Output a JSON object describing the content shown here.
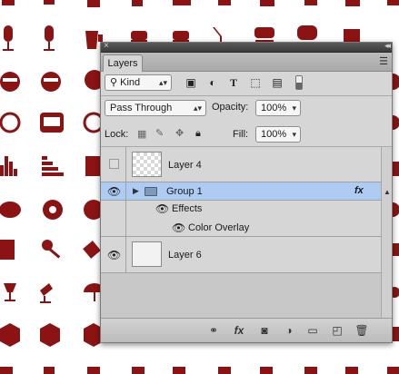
{
  "panel": {
    "tab_label": "Layers",
    "close_glyph": "×",
    "collapse_glyph": "◂◂",
    "menu_glyph": "☰"
  },
  "filter": {
    "kind_label": "Kind",
    "kind_icon": "search-icon",
    "filter_icons": [
      "image-filter-icon",
      "adjustment-filter-icon",
      "type-filter-icon",
      "shape-filter-icon",
      "smart-object-filter-icon"
    ]
  },
  "blend": {
    "mode": "Pass Through",
    "opacity_label": "Opacity:",
    "opacity_value": "100%",
    "fill_label": "Fill:",
    "fill_value": "100%",
    "lock_label": "Lock:"
  },
  "layers": [
    {
      "name": "Layer 4",
      "visible": false,
      "thumb": "transparent"
    },
    {
      "name": "Group 1",
      "visible": true,
      "selected": true,
      "fx": "fx",
      "effects_label": "Effects",
      "effect_items": [
        "Color Overlay"
      ]
    },
    {
      "name": "Layer 6",
      "visible": true,
      "thumb": "white"
    }
  ],
  "bottom_icons": [
    "link-layers-icon",
    "fx-icon",
    "add-mask-icon",
    "adjustment-layer-icon",
    "new-group-icon",
    "new-layer-icon",
    "delete-icon"
  ],
  "colors": {
    "icon_red": "#8b1313",
    "selection": "#aecbf3",
    "panel_bg": "#d6d6d6"
  }
}
